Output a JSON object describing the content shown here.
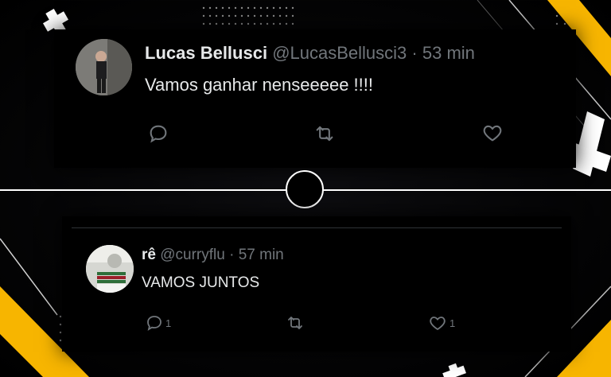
{
  "tweets": [
    {
      "display_name": "Lucas Bellusci",
      "handle": "@LucasBellusci3",
      "separator": " · ",
      "time": "53 min",
      "text": "Vamos ganhar nenseeeee !!!!",
      "reply_count": "",
      "like_count": ""
    },
    {
      "display_name": "rê",
      "handle": "@curryflu",
      "separator": " · ",
      "time": "57 min",
      "text": "VAMOS JUNTOS",
      "reply_count": "1",
      "like_count": "1"
    }
  ],
  "colors": {
    "accent_yellow": "#f7b500",
    "text_primary": "#e7e9ea",
    "text_secondary": "#71767b"
  },
  "icons": [
    "reply-icon",
    "retweet-icon",
    "like-icon",
    "plus-decoration"
  ]
}
